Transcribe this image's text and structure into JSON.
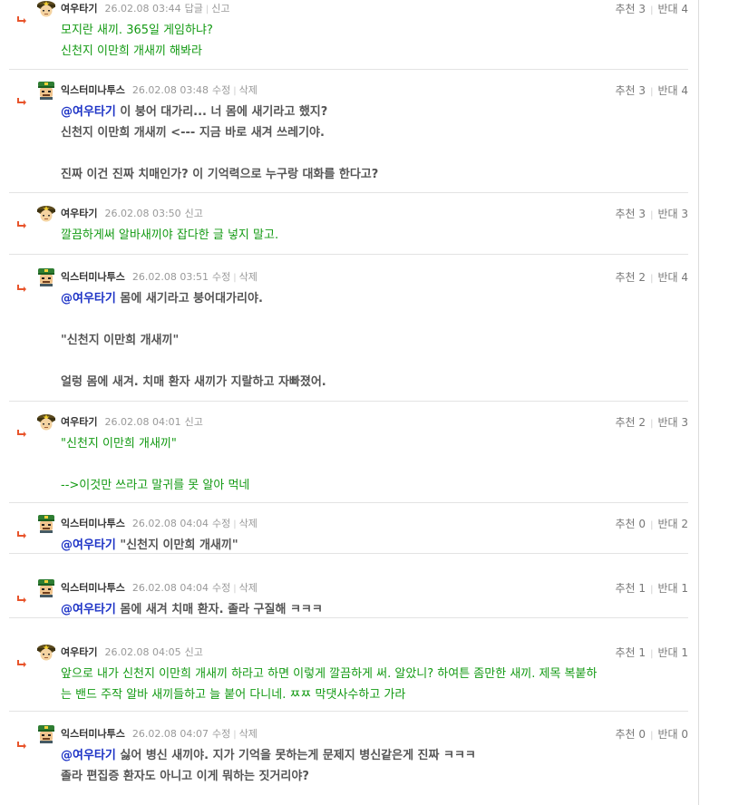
{
  "comments": [
    {
      "author": "여우타기",
      "avatar": "fox-officer-avatar",
      "date": "26.02.08 03:44",
      "actions": [
        "답글",
        "신고"
      ],
      "recommend_label": "추천",
      "recommend": "3",
      "oppose_label": "반대",
      "oppose": "4",
      "text_color": "green",
      "mention": "",
      "lines": [
        "모지란 새끼. 365일 게임하냐?",
        "신천지 이만희 개새끼 해봐라"
      ]
    },
    {
      "author": "익스터미나투스",
      "avatar": "soldier-avatar",
      "date": "26.02.08 03:48",
      "actions": [
        "수정",
        "삭제"
      ],
      "recommend_label": "추천",
      "recommend": "3",
      "oppose_label": "반대",
      "oppose": "4",
      "text_color": "gray",
      "mention": "@여우타기",
      "lines": [
        " 이 붕어 대가리... 너 몸에 새기라고 했지?",
        "신천지 이만희 개새끼 <--- 지금 바로 새겨 쓰레기야.",
        "",
        "진짜 이건 진짜 치매인가? 이 기억력으로 누구랑 대화를 한다고?"
      ]
    },
    {
      "author": "여우타기",
      "avatar": "fox-officer-avatar",
      "date": "26.02.08 03:50",
      "actions": [
        "신고"
      ],
      "recommend_label": "추천",
      "recommend": "3",
      "oppose_label": "반대",
      "oppose": "3",
      "text_color": "green",
      "mention": "",
      "lines": [
        "깔끔하게써 알바새끼야 잡다한 글 넣지 말고."
      ]
    },
    {
      "author": "익스터미나투스",
      "avatar": "soldier-avatar",
      "date": "26.02.08 03:51",
      "actions": [
        "수정",
        "삭제"
      ],
      "recommend_label": "추천",
      "recommend": "2",
      "oppose_label": "반대",
      "oppose": "4",
      "text_color": "gray",
      "mention": "@여우타기",
      "lines": [
        " 몸에 새기라고 붕어대가리야.",
        "",
        "\"신천지 이만희 개새끼\"",
        "",
        "얼렁 몸에 새겨. 치매 환자 새끼가 지랄하고 자빠졌어."
      ]
    },
    {
      "author": "여우타기",
      "avatar": "fox-officer-avatar",
      "date": "26.02.08 04:01",
      "actions": [
        "신고"
      ],
      "recommend_label": "추천",
      "recommend": "2",
      "oppose_label": "반대",
      "oppose": "3",
      "text_color": "green",
      "mention": "",
      "lines": [
        "\"신천지 이만희 개새끼\"",
        "",
        "-->이것만 쓰라고 말귀를 못 알아 먹네"
      ]
    },
    {
      "author": "익스터미나투스",
      "avatar": "soldier-avatar",
      "date": "26.02.08 04:04",
      "actions": [
        "수정",
        "삭제"
      ],
      "recommend_label": "추천",
      "recommend": "0",
      "oppose_label": "반대",
      "oppose": "2",
      "text_color": "gray",
      "mention": "@여우타기",
      "lines": [
        " \"신천지 이만희 개새끼\""
      ]
    },
    {
      "author": "익스터미나투스",
      "avatar": "soldier-avatar",
      "date": "26.02.08 04:04",
      "actions": [
        "수정",
        "삭제"
      ],
      "recommend_label": "추천",
      "recommend": "1",
      "oppose_label": "반대",
      "oppose": "1",
      "text_color": "gray",
      "mention": "@여우타기",
      "lines": [
        " 몸에 새겨 치매 환자. 졸라 구질해 ㅋㅋㅋ"
      ]
    },
    {
      "author": "여우타기",
      "avatar": "fox-officer-avatar",
      "date": "26.02.08 04:05",
      "actions": [
        "신고"
      ],
      "recommend_label": "추천",
      "recommend": "1",
      "oppose_label": "반대",
      "oppose": "1",
      "text_color": "green",
      "mention": "",
      "lines": [
        "앞으로 내가 신천지 이만희 개새끼 하라고 하면 이렇게 깔끔하게 써. 알았니? 하여튼 좀만한 새끼. 제목 복붙하",
        "는 밴드 주작 알바 새끼들하고 늘 붙어 다니네. ㅉㅉ 막댓사수하고 가라"
      ]
    },
    {
      "author": "익스터미나투스",
      "avatar": "soldier-avatar",
      "date": "26.02.08 04:07",
      "actions": [
        "수정",
        "삭제"
      ],
      "recommend_label": "추천",
      "recommend": "0",
      "oppose_label": "반대",
      "oppose": "0",
      "text_color": "gray",
      "mention": "@여우타기",
      "lines": [
        " 싫어 병신 새끼야. 지가 기억을 못하는게 문제지 병신같은게 진짜 ㅋㅋㅋ",
        "졸라 편집증 환자도 아니고 이게 뭐하는 짓거리야?"
      ]
    }
  ],
  "colors": {
    "green_text": "#139a13",
    "mention": "#1d33c6",
    "gray_text": "#555555",
    "reply_arrow": "#e8542b"
  }
}
